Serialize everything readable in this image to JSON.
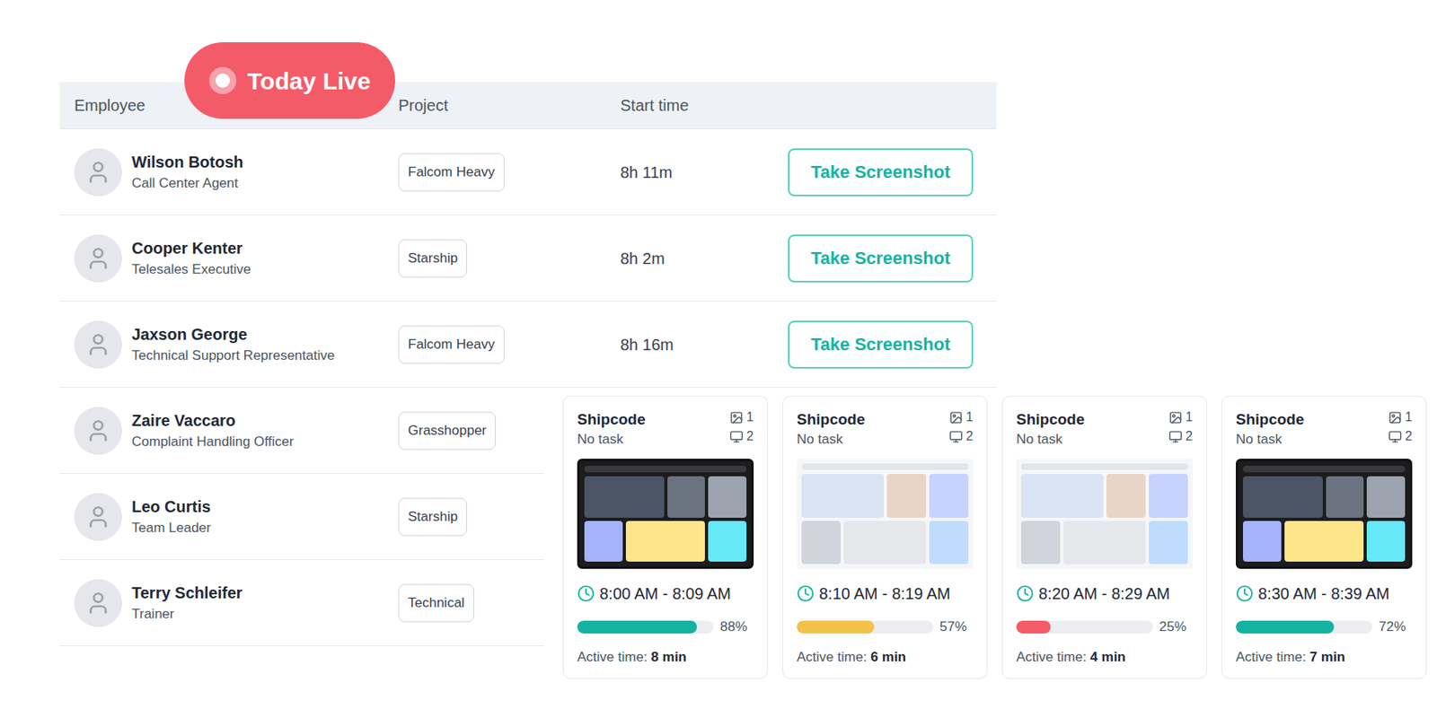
{
  "badge": {
    "label": "Today Live"
  },
  "table": {
    "columns": [
      "Employee",
      "Project",
      "Start time"
    ],
    "rows": [
      {
        "name": "Wilson Botosh",
        "role": "Call Center Agent",
        "project": "Falcom Heavy",
        "start_time": "8h 11m",
        "action": "Take Screenshot"
      },
      {
        "name": "Cooper Kenter",
        "role": "Telesales Executive",
        "project": "Starship",
        "start_time": "8h 2m",
        "action": "Take Screenshot"
      },
      {
        "name": "Jaxson George",
        "role": "Technical Support Representative",
        "project": "Falcom Heavy",
        "start_time": "8h 16m",
        "action": "Take Screenshot"
      },
      {
        "name": "Zaire Vaccaro",
        "role": "Complaint Handling Officer",
        "project": "Grasshopper"
      },
      {
        "name": "Leo Curtis",
        "role": "Team Leader",
        "project": "Starship"
      },
      {
        "name": "Terry Schleifer",
        "role": "Trainer",
        "project": "Technical"
      }
    ]
  },
  "cards": [
    {
      "project": "Shipcode",
      "task": "No task",
      "images": "1",
      "screens": "2",
      "kind": "dark",
      "time": "8:00 AM - 8:09 AM",
      "level": 0.88,
      "percent": "88%",
      "color": "#14b3a1",
      "active_label": "Active time:",
      "active_value": "8 min"
    },
    {
      "project": "Shipcode",
      "task": "No task",
      "images": "1",
      "screens": "2",
      "kind": "light",
      "time": "8:10 AM - 8:19 AM",
      "level": 0.57,
      "percent": "57%",
      "color": "#f2c14a",
      "active_label": "Active time:",
      "active_value": "6 min"
    },
    {
      "project": "Shipcode",
      "task": "No task",
      "images": "1",
      "screens": "2",
      "kind": "light",
      "time": "8:20 AM - 8:29 AM",
      "level": 0.25,
      "percent": "25%",
      "color": "#f45b69",
      "active_label": "Active time:",
      "active_value": "4 min"
    },
    {
      "project": "Shipcode",
      "task": "No task",
      "images": "1",
      "screens": "2",
      "kind": "dark",
      "time": "8:30 AM - 8:39 AM",
      "level": 0.72,
      "percent": "72%",
      "color": "#14b3a1",
      "active_label": "Active time:",
      "active_value": "7 min"
    }
  ]
}
